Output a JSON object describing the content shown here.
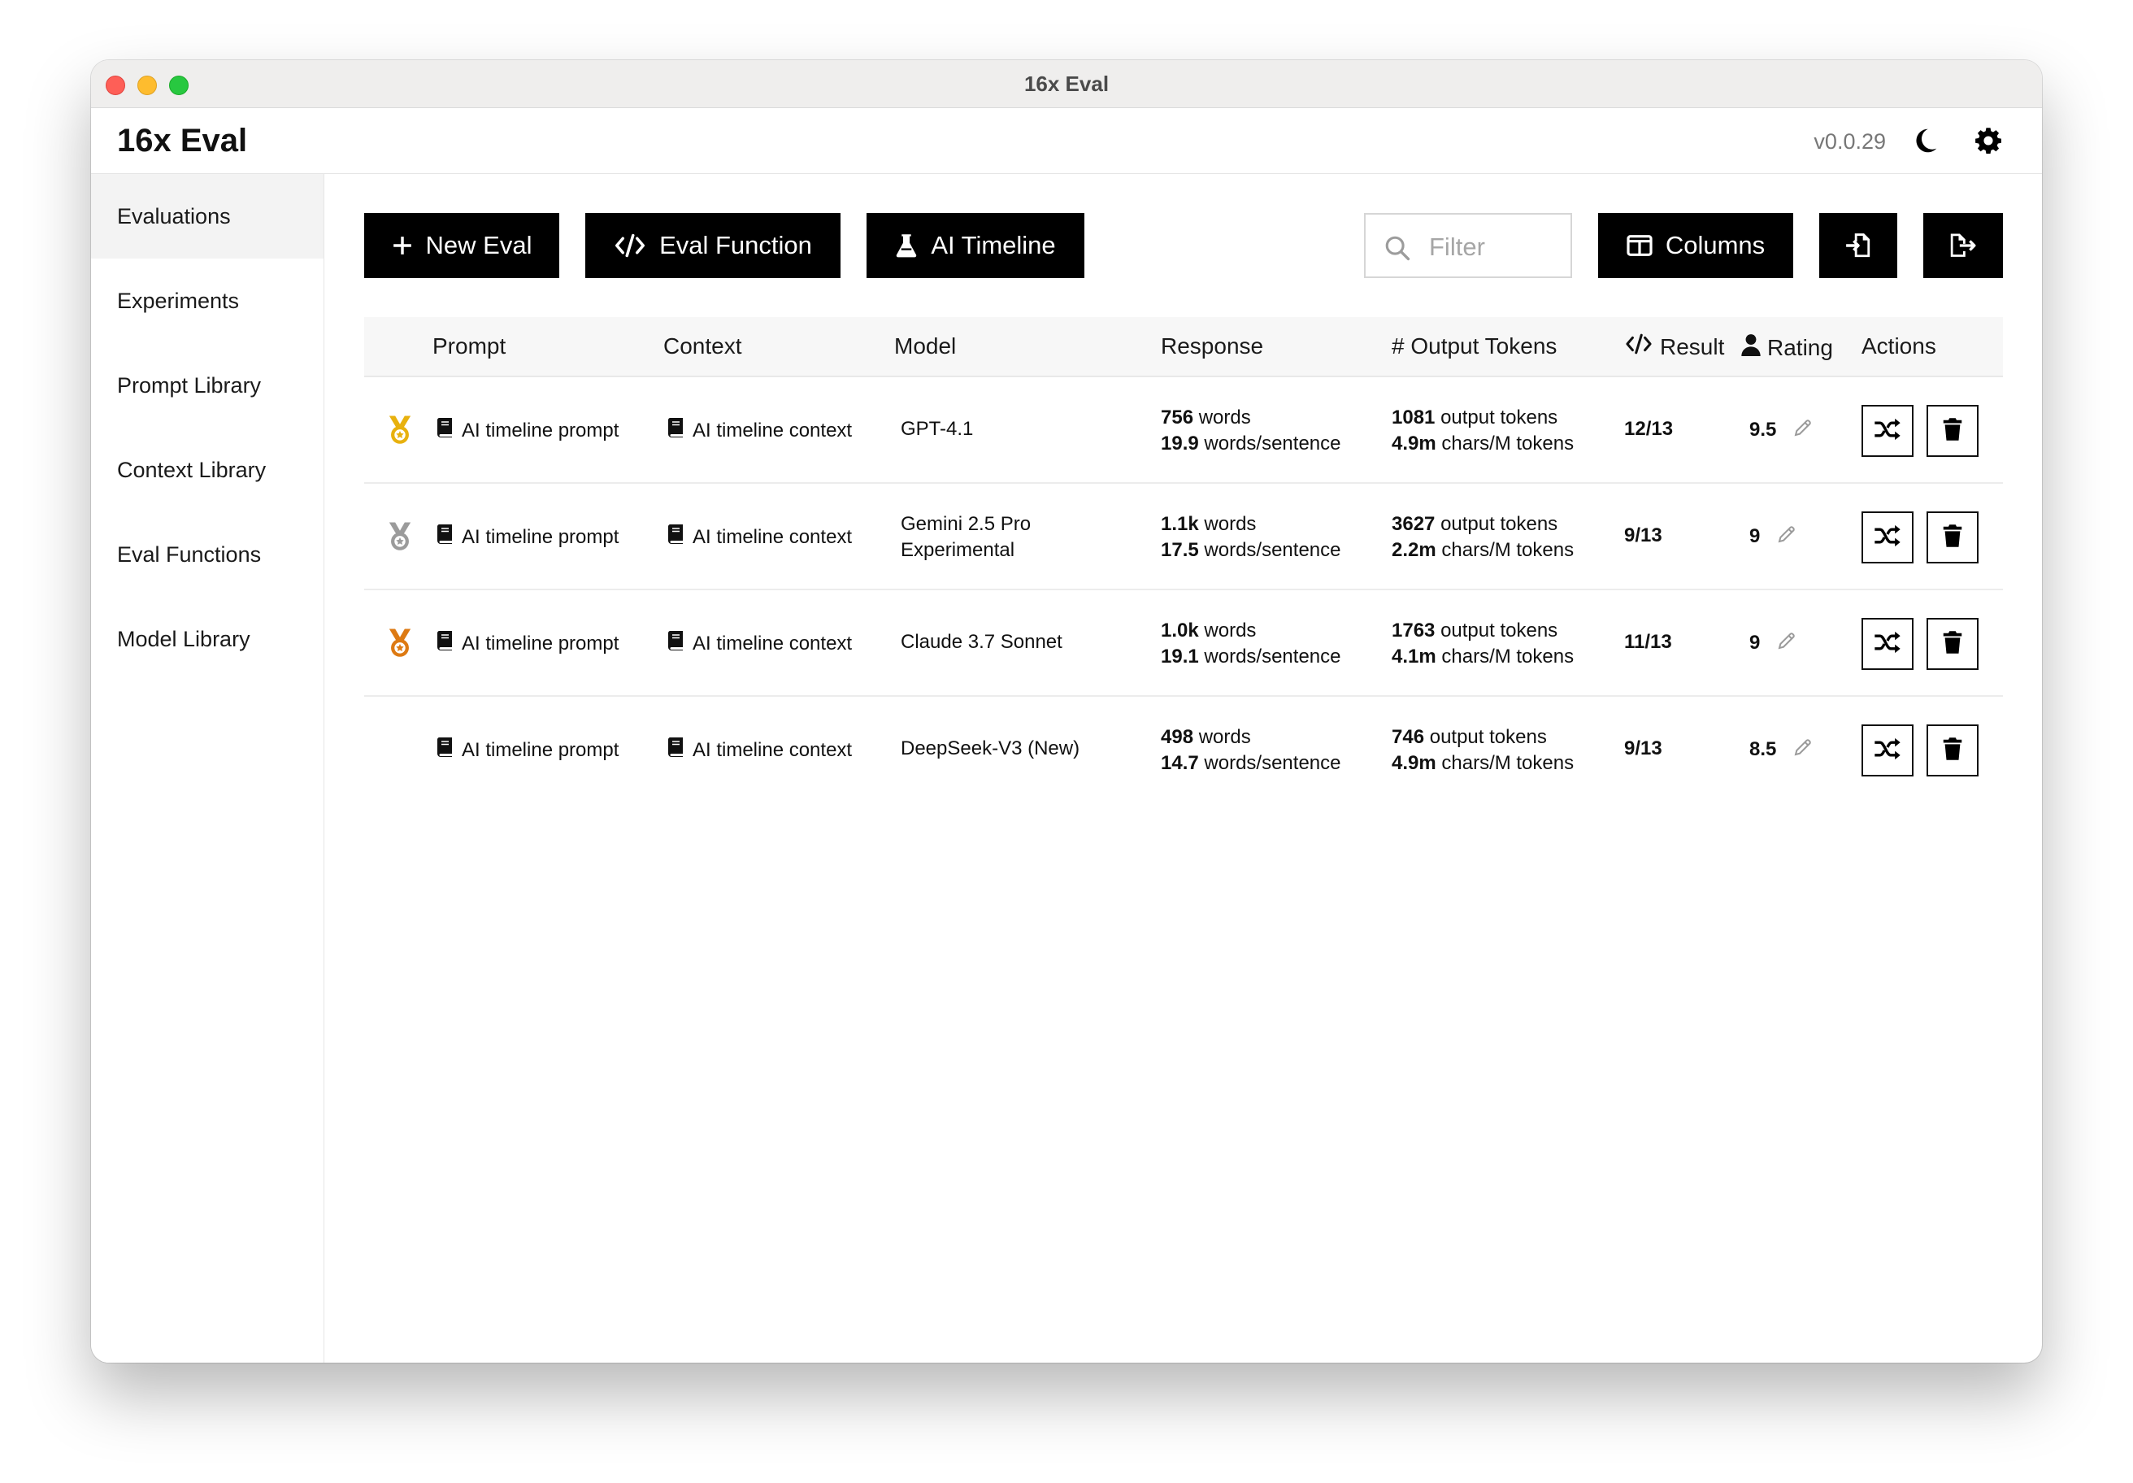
{
  "window": {
    "title": "16x Eval"
  },
  "header": {
    "app_name": "16x Eval",
    "version": "v0.0.29"
  },
  "sidebar": {
    "items": [
      {
        "label": "Evaluations",
        "active": true
      },
      {
        "label": "Experiments",
        "active": false
      },
      {
        "label": "Prompt Library",
        "active": false
      },
      {
        "label": "Context Library",
        "active": false
      },
      {
        "label": "Eval Functions",
        "active": false
      },
      {
        "label": "Model Library",
        "active": false
      }
    ]
  },
  "toolbar": {
    "new_eval": "New Eval",
    "eval_function": "Eval Function",
    "ai_timeline": "AI Timeline",
    "filter_placeholder": "Filter",
    "columns": "Columns"
  },
  "table": {
    "headers": {
      "prompt": "Prompt",
      "context": "Context",
      "model": "Model",
      "response": "Response",
      "output_tokens": "# Output Tokens",
      "result": "Result",
      "rating": "Rating",
      "actions": "Actions"
    },
    "rows": [
      {
        "medal": "gold",
        "medal_color": "#e8b10e",
        "prompt": "AI timeline prompt",
        "context": "AI timeline context",
        "model_line1": "GPT-4.1",
        "model_line2": "",
        "words_value": "756",
        "words_label": "words",
        "wps_value": "19.9",
        "wps_label": "words/sentence",
        "tokens_value": "1081",
        "tokens_label": "output tokens",
        "cpt_value": "4.9m",
        "cpt_label": "chars/M tokens",
        "result": "12/13",
        "rating": "9.5"
      },
      {
        "medal": "silver",
        "medal_color": "#9b9b9b",
        "prompt": "AI timeline prompt",
        "context": "AI timeline context",
        "model_line1": "Gemini 2.5 Pro",
        "model_line2": "Experimental",
        "words_value": "1.1k",
        "words_label": "words",
        "wps_value": "17.5",
        "wps_label": "words/sentence",
        "tokens_value": "3627",
        "tokens_label": "output tokens",
        "cpt_value": "2.2m",
        "cpt_label": "chars/M tokens",
        "result": "9/13",
        "rating": "9"
      },
      {
        "medal": "bronze",
        "medal_color": "#dd7a13",
        "prompt": "AI timeline prompt",
        "context": "AI timeline context",
        "model_line1": "Claude 3.7 Sonnet",
        "model_line2": "",
        "words_value": "1.0k",
        "words_label": "words",
        "wps_value": "19.1",
        "wps_label": "words/sentence",
        "tokens_value": "1763",
        "tokens_label": "output tokens",
        "cpt_value": "4.1m",
        "cpt_label": "chars/M tokens",
        "result": "11/13",
        "rating": "9"
      },
      {
        "medal": "none",
        "medal_color": "",
        "prompt": "AI timeline prompt",
        "context": "AI timeline context",
        "model_line1": "DeepSeek-V3 (New)",
        "model_line2": "",
        "words_value": "498",
        "words_label": "words",
        "wps_value": "14.7",
        "wps_label": "words/sentence",
        "tokens_value": "746",
        "tokens_label": "output tokens",
        "cpt_value": "4.9m",
        "cpt_label": "chars/M tokens",
        "result": "9/13",
        "rating": "8.5"
      }
    ]
  },
  "icons": {
    "window_controls": [
      "close-icon",
      "minimize-icon",
      "zoom-icon"
    ],
    "header": [
      "moon-icon",
      "gear-icon"
    ],
    "toolbar": [
      "plus-icon",
      "code-icon",
      "flask-icon",
      "search-icon",
      "columns-icon",
      "import-icon",
      "export-icon"
    ],
    "table": [
      "medal-icon",
      "book-icon",
      "pencil-icon",
      "shuffle-icon",
      "trash-icon",
      "user-icon"
    ]
  }
}
